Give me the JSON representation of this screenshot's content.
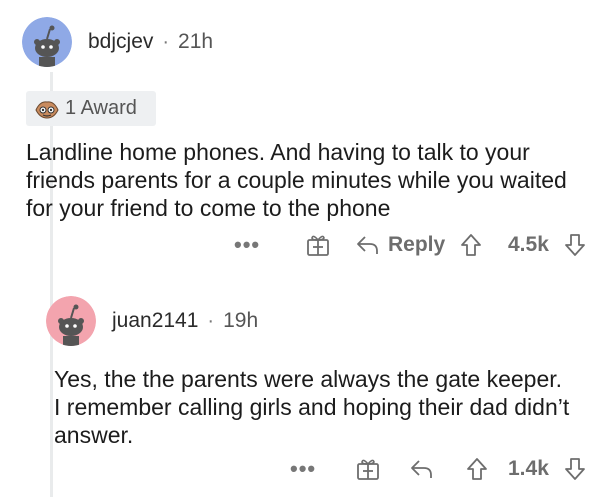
{
  "comment1": {
    "username": "bdjcjev",
    "time": "21h",
    "award_label": "1 Award",
    "body": "Landline home phones. And having to talk to your friends parents for a couple minutes while you waited for your friend to come to the phone",
    "actions": {
      "more": "•••",
      "reply_label": "Reply",
      "score": "4.5k"
    }
  },
  "comment2": {
    "username": "juan2141",
    "time": "19h",
    "body": "Yes, the the parents were always the gate keeper.  I remember calling girls and hoping their dad didn’t answer.",
    "actions": {
      "more": "•••",
      "score": "1.4k"
    }
  },
  "colors": {
    "avatar1_bg": "#8fa9e6",
    "avatar2_bg": "#f3a4ae",
    "meta_dot": "·"
  }
}
